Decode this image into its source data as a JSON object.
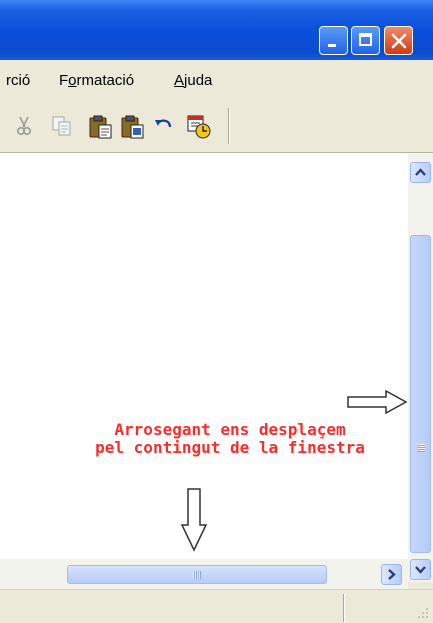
{
  "menu": {
    "items": [
      {
        "pre": "rció",
        "ul": "",
        "post": ""
      },
      {
        "pre": "F",
        "ul": "o",
        "post": "rmatació"
      },
      {
        "pre": "",
        "ul": "A",
        "post": "juda"
      }
    ]
  },
  "toolbar": {
    "tools": [
      "cut-icon",
      "copy-icon",
      "paste-icon",
      "undo-icon",
      "date-time-icon"
    ]
  },
  "annotation": {
    "line1": "Arrosegant ens desplaçem",
    "line2": "pel contingut de la finestra",
    "color": "#ff2b2b"
  },
  "colors": {
    "titlebar": "#0a4ed9",
    "chrome": "#ece9d8",
    "scrollbar_thumb": "#c7d8fb"
  }
}
